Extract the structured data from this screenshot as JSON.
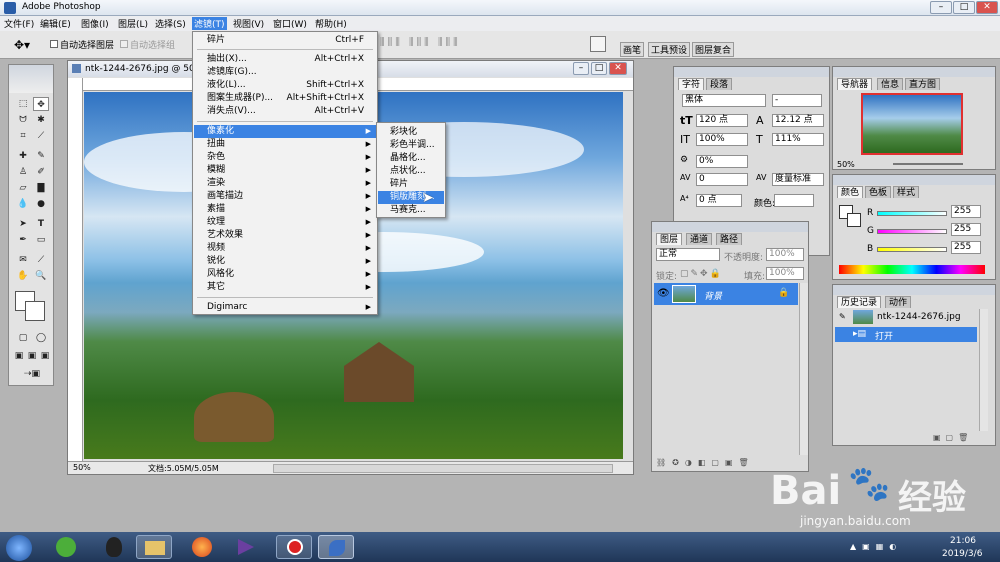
{
  "app": {
    "title": "Adobe Photoshop"
  },
  "menubar": [
    "文件(F)",
    "编辑(E)",
    "图像(I)",
    "图层(L)",
    "选择(S)",
    "滤镜(T)",
    "视图(V)",
    "窗口(W)",
    "帮助(H)"
  ],
  "options": {
    "auto_select_layer": "自动选择图层",
    "auto_select_group": "自动选择组",
    "tabs": [
      "画笔",
      "工具预设",
      "图层复合"
    ]
  },
  "document": {
    "title": "ntk-1244-2676.jpg @ 50",
    "zoom": "50%",
    "status": "文档:5.05M/5.05M"
  },
  "filter_menu": {
    "items": [
      {
        "label": "碎片",
        "shortcut": "Ctrl+F"
      },
      {
        "label": "抽出(X)...",
        "shortcut": "Alt+Ctrl+X"
      },
      {
        "label": "滤镜库(G)...",
        "shortcut": ""
      },
      {
        "label": "液化(L)...",
        "shortcut": "Shift+Ctrl+X"
      },
      {
        "label": "图案生成器(P)...",
        "shortcut": "Alt+Shift+Ctrl+X"
      },
      {
        "label": "消失点(V)...",
        "shortcut": "Alt+Ctrl+V"
      },
      {
        "label": "像素化",
        "shortcut": ""
      },
      {
        "label": "扭曲",
        "shortcut": ""
      },
      {
        "label": "杂色",
        "shortcut": ""
      },
      {
        "label": "模糊",
        "shortcut": ""
      },
      {
        "label": "渲染",
        "shortcut": ""
      },
      {
        "label": "画笔描边",
        "shortcut": ""
      },
      {
        "label": "素描",
        "shortcut": ""
      },
      {
        "label": "纹理",
        "shortcut": ""
      },
      {
        "label": "艺术效果",
        "shortcut": ""
      },
      {
        "label": "视频",
        "shortcut": ""
      },
      {
        "label": "锐化",
        "shortcut": ""
      },
      {
        "label": "风格化",
        "shortcut": ""
      },
      {
        "label": "其它",
        "shortcut": ""
      },
      {
        "label": "Digimarc",
        "shortcut": ""
      }
    ]
  },
  "pixelate_submenu": [
    "彩块化",
    "彩色半调...",
    "晶格化...",
    "点状化...",
    "碎片",
    "铜版雕刻...",
    "马赛克..."
  ],
  "character_panel": {
    "tabs": [
      "字符",
      "段落"
    ],
    "font": "黑体",
    "style": "-",
    "size": "120 点",
    "leading": "12.12 点",
    "vscale": "100%",
    "hscale": "111%",
    "tracking_ratio": "0%",
    "kerning": "0",
    "tracking_mode": "度量标准",
    "baseline": "0 点",
    "color_label": "颜色:"
  },
  "layers_panel": {
    "tabs": [
      "图层",
      "通道",
      "路径"
    ],
    "blend_mode": "正常",
    "opacity_label": "不透明度:",
    "opacity": "100%",
    "lock_label": "锁定:",
    "fill_label": "填充:",
    "fill": "100%",
    "layer_name": "背景"
  },
  "navigator": {
    "tabs": [
      "导航器",
      "信息",
      "直方图"
    ],
    "zoom": "50%"
  },
  "color_panel": {
    "tabs": [
      "颜色",
      "色板",
      "样式"
    ],
    "r_label": "R",
    "g_label": "G",
    "b_label": "B",
    "r": "255",
    "g": "255",
    "b": "255"
  },
  "history_panel": {
    "tabs": [
      "历史记录",
      "动作"
    ],
    "snapshot": "ntk-1244-2676.jpg",
    "step": "打开"
  },
  "taskbar": {
    "time": "21:06",
    "date": "2019/3/6"
  },
  "watermark": {
    "brand": "Bai",
    "brand2": "经验",
    "url": "jingyan.baidu.com"
  }
}
